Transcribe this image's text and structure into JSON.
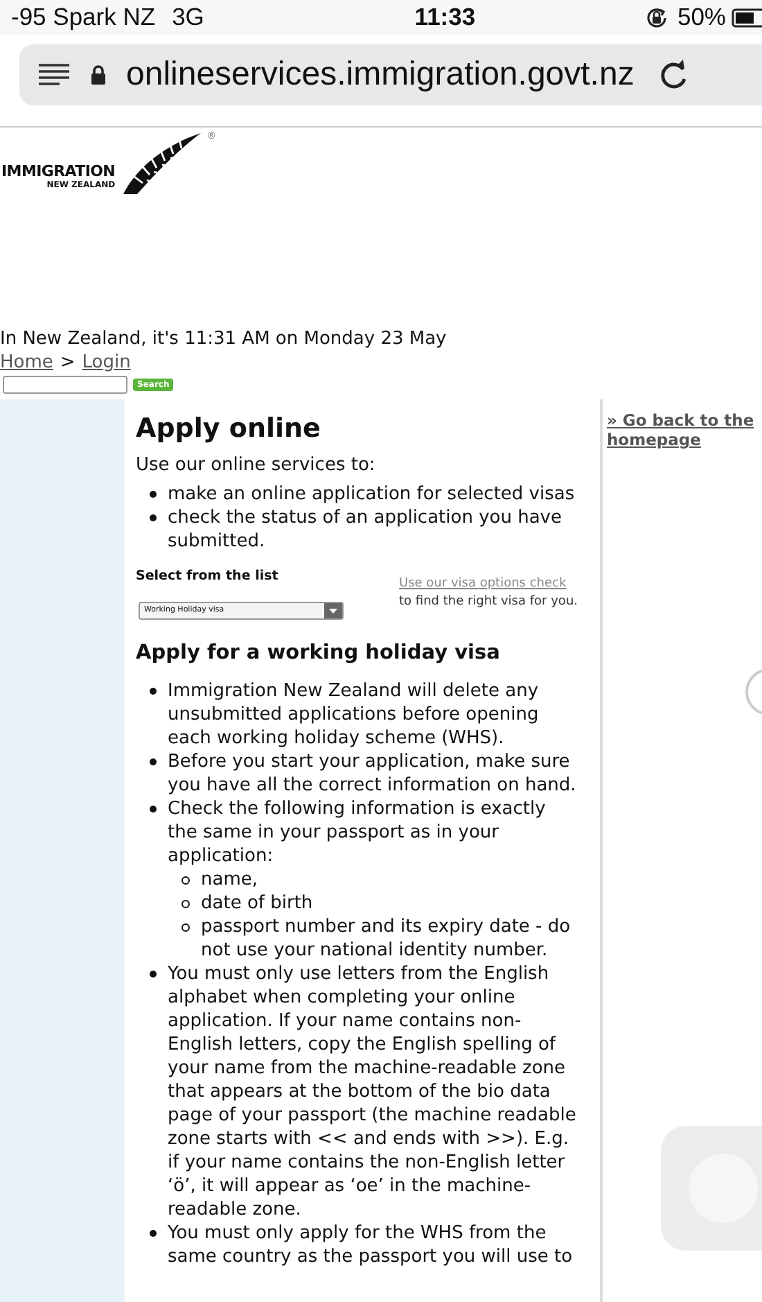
{
  "status_bar": {
    "carrier": "-95 Spark NZ",
    "network": "3G",
    "time": "11:33",
    "battery": "50%"
  },
  "browser": {
    "url": "onlineservices.immigration.govt.nz"
  },
  "header": {
    "logo_line_1": "IMMIGRATION",
    "logo_line_2": "NEW ZEALAND",
    "registered_mark": "®"
  },
  "date_line": "In New Zealand, it's 11:31 AM on Monday 23 May",
  "breadcrumb": [
    {
      "label": "Home",
      "kind": "link"
    },
    {
      "label": ">",
      "kind": "separator"
    },
    {
      "label": "Login",
      "kind": "link"
    }
  ],
  "search": {
    "button": "Search"
  },
  "main": {
    "title": "Apply online",
    "intro": "Use our online services to:",
    "services": [
      "make an online application for selected visas",
      "check the status of an application you have submitted."
    ],
    "select_label": "Select from the list",
    "select_value": "Working Holiday visa",
    "help_link": "Use our visa options check",
    "help_text": "to find the right visa for you.",
    "section_title": "Apply for a working holiday visa",
    "items": [
      {
        "text": "Immigration New Zealand will delete any unsubmitted applications before opening each working holiday scheme (WHS)."
      },
      {
        "text": "Before you start your application, make sure you have all the correct information on hand."
      },
      {
        "text": "Check the following information is exactly the same in your passport as in your application:",
        "children": [
          {
            "text": "name,"
          },
          {
            "text": "date of birth"
          },
          {
            "text": "passport number and its expiry date - do not use your national identity number."
          }
        ]
      },
      {
        "text": "You must only use letters from the English alphabet when completing your online application. If your name contains non-English letters, copy the English spelling of your name from the machine-readable zone that appears at the bottom of the bio data page of your passport (the machine readable zone starts with << and ends with >>). E.g. if your name contains the non-English letter ‘ö’, it will appear as ‘oe’ in the machine-readable zone."
      },
      {
        "text": "You must only apply for the WHS from the same country as the passport you will use to"
      }
    ]
  },
  "sidebar": {
    "link": "» Go back to the homepage"
  }
}
